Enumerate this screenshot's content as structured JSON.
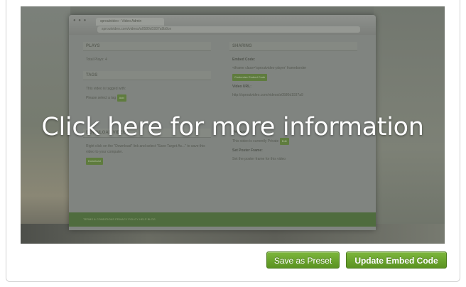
{
  "video": {
    "overlay_text": "Click here for more information",
    "browser": {
      "tab_title": "sproutvideo - Video Admin",
      "url": "sproutvideo.com/videos/a0580d1937a9b8ce"
    },
    "left_column": {
      "plays_heading": "PLAYS",
      "plays_text": "Total Plays: 4",
      "tags_heading": "TAGS",
      "tags_text": "This video is tagged with:",
      "tag_select": "Please select a tag",
      "tag_add": "Add",
      "download_heading": "DOWNLOAD VIDEO",
      "download_text": "Right click on the \"Download\" link and select \"Save Target As...\" to save this video to your computer.",
      "download_button": "Download"
    },
    "right_column": {
      "sharing_heading": "SHARING",
      "embed_label": "Embed Code:",
      "embed_value": "<iframe class='sproutvideo-player' frameborder",
      "embed_button": "Customize Embed Code",
      "url_label": "Video URL:",
      "url_value": "http://sproutvideo.com/videos/a0580d1937a9",
      "privacy_label": "Privacy:",
      "privacy_text": "This video is currently Private",
      "privacy_button": "Edit",
      "poster_label": "Set Poster Frame:",
      "poster_text": "Set the poster frame for this video"
    },
    "footer_links": "TERMS & CONDITIONS   PRIVACY POLICY   HELP   BLOG"
  },
  "actions": {
    "save_preset_label": "Save as Preset",
    "update_embed_label": "Update Embed Code"
  },
  "colors": {
    "button_green": "#6aa52e",
    "overlay_text": "#ffffff"
  }
}
